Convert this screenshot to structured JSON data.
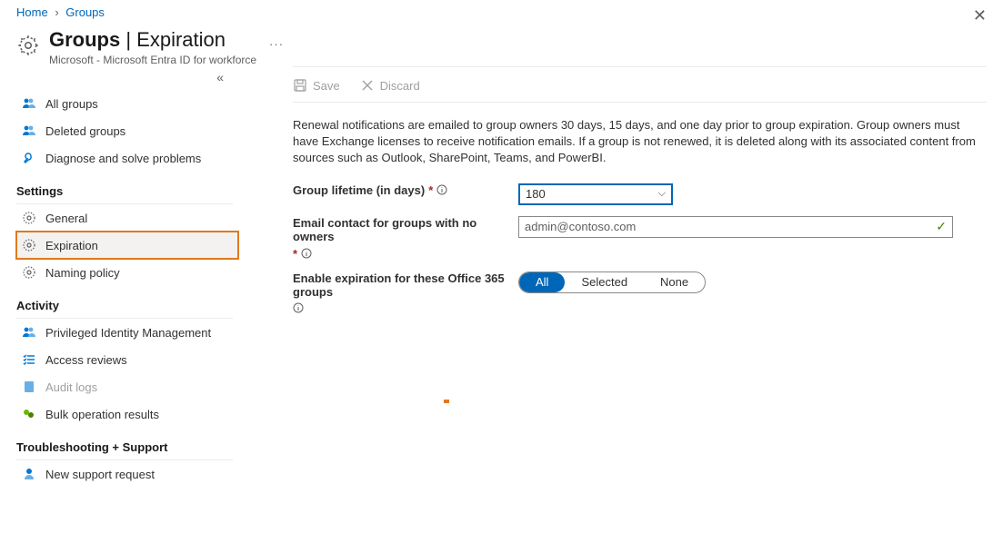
{
  "breadcrumbs": {
    "home": "Home",
    "groups": "Groups"
  },
  "header": {
    "title_bold": "Groups",
    "title_rest": " | Expiration",
    "subtitle": "Microsoft - Microsoft Entra ID for workforce"
  },
  "toolbar": {
    "save": "Save",
    "discard": "Discard"
  },
  "nav": {
    "all_groups": "All groups",
    "deleted_groups": "Deleted groups",
    "diagnose": "Diagnose and solve problems",
    "section_settings": "Settings",
    "general": "General",
    "expiration": "Expiration",
    "naming_policy": "Naming policy",
    "section_activity": "Activity",
    "pim": "Privileged Identity Management",
    "access_reviews": "Access reviews",
    "audit_logs": "Audit logs",
    "bulk_results": "Bulk operation results",
    "section_troubleshoot": "Troubleshooting + Support",
    "new_support": "New support request"
  },
  "main": {
    "info": "Renewal notifications are emailed to group owners 30 days, 15 days, and one day prior to group expiration. Group owners must have Exchange licenses to receive notification emails. If a group is not renewed, it is deleted along with its associated content from sources such as Outlook, SharePoint, Teams, and PowerBI.",
    "lifetime_label": "Group lifetime (in days)",
    "lifetime_value": "180",
    "email_label": "Email contact for groups with no owners",
    "email_value": "admin@contoso.com",
    "enable_label": "Enable expiration for these Office 365 groups",
    "pills": {
      "all": "All",
      "selected": "Selected",
      "none": "None"
    }
  }
}
